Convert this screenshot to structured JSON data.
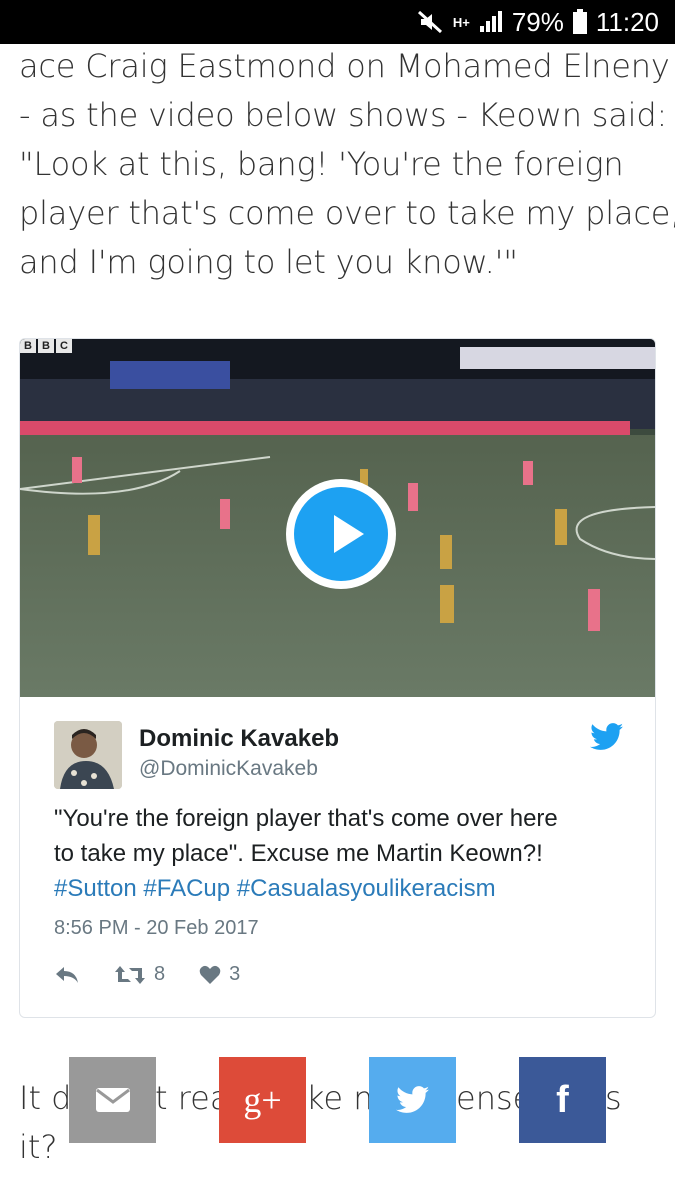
{
  "status_bar": {
    "network": "H+",
    "battery": "79%",
    "time": "11:20"
  },
  "article": {
    "lines": [
      "ace Craig Eastmond on Mohamed Elneny",
      "- as the video below shows - Keown said:",
      "\"Look at this, bang! 'You're the foreign",
      "player that's come over to take my place,",
      "and I'm going to let you know.'\""
    ]
  },
  "tweet": {
    "video_logo": [
      "B",
      "B",
      "C"
    ],
    "author_name": "Dominic Kavakeb",
    "author_handle": "@DominicKavakeb",
    "text_line1": "\"You're the foreign player that's come over here",
    "text_line2": "to take my place\". Excuse me Martin Keown?!",
    "hashtags": "#Sutton #FACup #Casualasyoulikeracism",
    "timestamp": "8:56 PM - 20 Feb 2017",
    "retweets": "8",
    "likes": "3"
  },
  "bottom_text": {
    "line1": "It d",
    "line1b": "t rea",
    "line1c": "ke m",
    "line1d": "ense",
    "line1e": "s",
    "line2": "it?"
  },
  "share": {
    "icons": [
      "envelope-icon",
      "google-plus-icon",
      "twitter-icon",
      "facebook-icon"
    ],
    "gplus_label": "g+",
    "facebook_label": "f"
  },
  "colors": {
    "email": "#999999",
    "google_plus": "#dd4b39",
    "twitter": "#55acee",
    "facebook": "#3b5998",
    "hashtag": "#2b7bb9",
    "play_button": "#1da1f2"
  }
}
